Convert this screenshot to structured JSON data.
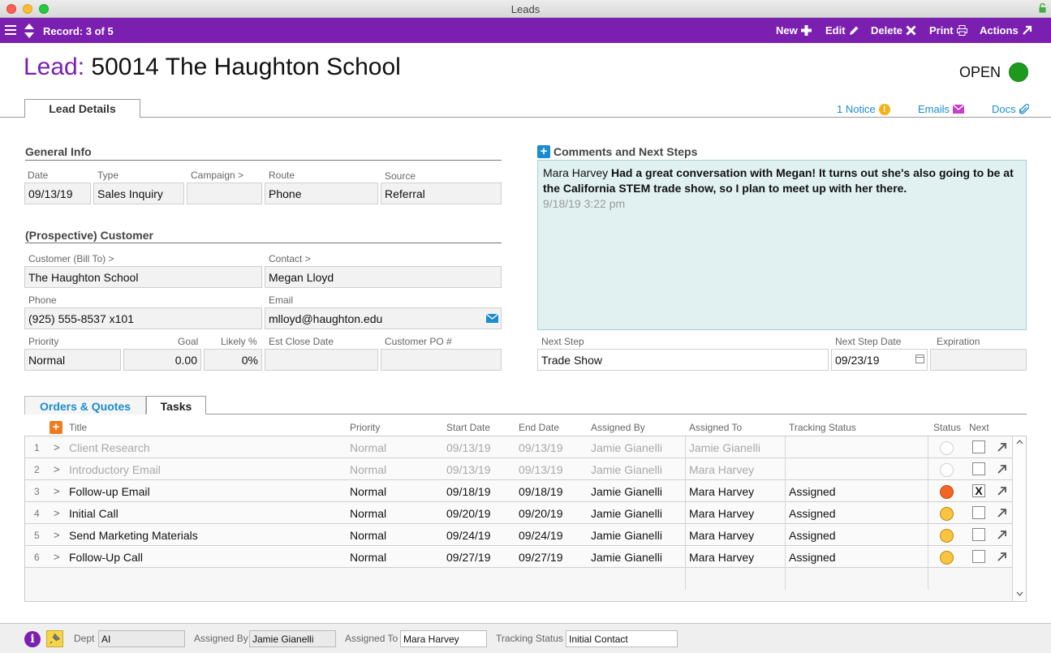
{
  "window": {
    "title": "Leads"
  },
  "toolbar": {
    "record_label": "Record: 3 of 5",
    "buttons": [
      "New",
      "Edit",
      "Delete",
      "Print",
      "Actions"
    ]
  },
  "header": {
    "title_label": "Lead:",
    "title_value": "50014 The Haughton School",
    "status": "OPEN",
    "status_color": "#1d9a1d",
    "tab": "Lead Details",
    "links": {
      "notice": "1 Notice",
      "emails": "Emails",
      "docs": "Docs"
    }
  },
  "general_info": {
    "title": "General Info",
    "labels": {
      "date": "Date",
      "type": "Type",
      "campaign": "Campaign >",
      "route": "Route",
      "source": "Source"
    },
    "values": {
      "date": "09/13/19",
      "type": "Sales Inquiry",
      "campaign": "",
      "route": "Phone",
      "source": "Referral"
    }
  },
  "customer": {
    "title": "(Prospective) Customer",
    "labels": {
      "customer": "Customer (Bill To) >",
      "contact": "Contact >",
      "phone": "Phone",
      "email": "Email",
      "priority": "Priority",
      "goal": "Goal",
      "likely": "Likely %",
      "est_close": "Est Close Date",
      "po": "Customer PO #"
    },
    "values": {
      "customer": "The Haughton School",
      "contact": "Megan Lloyd",
      "phone": "(925) 555-8537 x101",
      "email": "mlloyd@haughton.edu",
      "priority": "Normal",
      "goal": "0.00",
      "likely": "0%",
      "est_close": "",
      "po": ""
    }
  },
  "comments": {
    "title": "Comments and Next Steps",
    "author": "Mara Harvey",
    "text": "Had a great conversation with Megan! It turns out she's also going to be at the California STEM trade show, so I plan to meet up with her there.",
    "timestamp": "9/18/19  3:22 pm"
  },
  "next_step": {
    "labels": {
      "step": "Next Step",
      "date": "Next Step Date",
      "expiration": "Expiration"
    },
    "values": {
      "step": "Trade Show",
      "date": "09/23/19",
      "expiration": ""
    }
  },
  "lower_tabs": [
    "Orders & Quotes",
    "Tasks"
  ],
  "tasks": {
    "columns": [
      "Title",
      "Priority",
      "Start Date",
      "End Date",
      "Assigned By",
      "Assigned To",
      "Tracking Status",
      "Status",
      "Next"
    ],
    "rows": [
      {
        "num": "1",
        "title": "Client Research",
        "priority": "Normal",
        "start": "09/13/19",
        "end": "09/13/19",
        "by": "Jamie Gianelli",
        "to": "Jamie Gianelli",
        "tracking": "",
        "status": "empty",
        "next": ""
      },
      {
        "num": "2",
        "title": "Introductory Email",
        "priority": "Normal",
        "start": "09/13/19",
        "end": "09/13/19",
        "by": "Jamie Gianelli",
        "to": "Mara Harvey",
        "tracking": "",
        "status": "empty",
        "next": ""
      },
      {
        "num": "3",
        "title": "Follow-up Email",
        "priority": "Normal",
        "start": "09/18/19",
        "end": "09/18/19",
        "by": "Jamie Gianelli",
        "to": "Mara Harvey",
        "tracking": "Assigned",
        "status": "orange",
        "next": "X"
      },
      {
        "num": "4",
        "title": "Initial Call",
        "priority": "Normal",
        "start": "09/20/19",
        "end": "09/20/19",
        "by": "Jamie Gianelli",
        "to": "Mara Harvey",
        "tracking": "Assigned",
        "status": "yellow",
        "next": ""
      },
      {
        "num": "5",
        "title": "Send Marketing Materials",
        "priority": "Normal",
        "start": "09/24/19",
        "end": "09/24/19",
        "by": "Jamie Gianelli",
        "to": "Mara Harvey",
        "tracking": "Assigned",
        "status": "yellow",
        "next": ""
      },
      {
        "num": "6",
        "title": "Follow-Up Call",
        "priority": "Normal",
        "start": "09/27/19",
        "end": "09/27/19",
        "by": "Jamie Gianelli",
        "to": "Mara Harvey",
        "tracking": "Assigned",
        "status": "yellow",
        "next": ""
      }
    ]
  },
  "status_colors": {
    "orange": "#f26522",
    "yellow": "#f9c440",
    "empty": "#ffffff"
  },
  "footer": {
    "labels": {
      "dept": "Dept",
      "assigned_by": "Assigned By",
      "assigned_to": "Assigned To",
      "tracking": "Tracking Status"
    },
    "values": {
      "dept": "AI",
      "assigned_by": "Jamie Gianelli",
      "assigned_to": "Mara Harvey",
      "tracking": "Initial Contact"
    }
  }
}
